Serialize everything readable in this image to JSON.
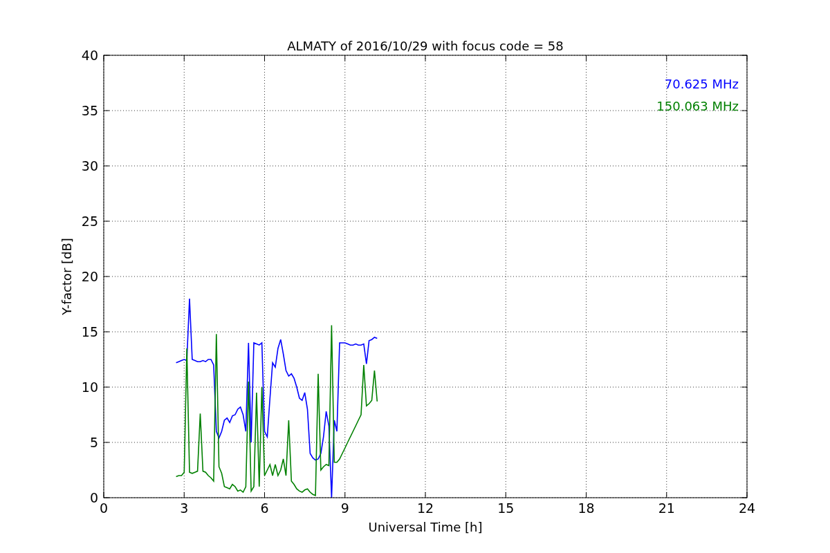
{
  "figure": {
    "chart_data": {
      "type": "line",
      "title": "ALMATY of 2016/10/29 with focus code = 58",
      "xlabel": "Universal Time [h]",
      "ylabel": "Y-factor [dB]",
      "x": [
        2.7,
        2.8,
        2.9,
        3.0,
        3.1,
        3.2,
        3.3,
        3.4,
        3.5,
        3.6,
        3.7,
        3.8,
        3.9,
        4.0,
        4.1,
        4.2,
        4.3,
        4.4,
        4.5,
        4.6,
        4.7,
        4.8,
        4.9,
        5.0,
        5.1,
        5.2,
        5.3,
        5.4,
        5.5,
        5.6,
        5.7,
        5.8,
        5.9,
        6.0,
        6.1,
        6.2,
        6.3,
        6.4,
        6.5,
        6.6,
        6.7,
        6.8,
        6.9,
        7.0,
        7.1,
        7.2,
        7.3,
        7.4,
        7.5,
        7.6,
        7.7,
        7.8,
        7.9,
        8.0,
        8.1,
        8.2,
        8.3,
        8.4,
        8.5,
        8.6,
        8.7,
        8.8,
        8.9,
        9.0,
        9.1,
        9.2,
        9.3,
        9.4,
        9.5,
        9.6,
        9.7,
        9.8,
        9.9,
        10.0,
        10.1,
        10.2
      ],
      "series": [
        {
          "name": "70.625 MHz",
          "color": "#0000ff",
          "values": [
            12.2,
            12.3,
            12.4,
            12.5,
            12.4,
            18.0,
            12.5,
            12.4,
            12.3,
            12.3,
            12.4,
            12.3,
            12.5,
            12.5,
            12.0,
            6.0,
            5.4,
            6.0,
            7.0,
            7.2,
            6.8,
            7.4,
            7.5,
            8.0,
            8.2,
            7.5,
            6.0,
            14.0,
            5.0,
            14.0,
            13.9,
            13.8,
            14.0,
            6.0,
            5.5,
            9.0,
            12.2,
            11.8,
            13.5,
            14.3,
            13.0,
            11.5,
            11.0,
            11.2,
            10.8,
            10.0,
            9.0,
            8.8,
            9.5,
            8.0,
            4.0,
            3.6,
            3.4,
            3.5,
            4.0,
            5.5,
            7.8,
            6.5,
            0,
            7.0,
            6.0,
            14.0,
            14.0,
            14.0,
            13.9,
            13.8,
            13.8,
            13.9,
            13.8,
            13.8,
            13.9,
            12.1,
            14.2,
            14.3,
            14.5,
            14.4
          ]
        },
        {
          "name": "150.063 MHz",
          "color": "#008000",
          "values": [
            1.9,
            2.0,
            2.0,
            2.3,
            13.5,
            2.3,
            2.2,
            2.3,
            2.4,
            7.6,
            2.4,
            2.3,
            2.0,
            1.8,
            1.5,
            14.8,
            2.8,
            2.2,
            1.0,
            0.9,
            0.8,
            1.2,
            1.0,
            0.6,
            0.7,
            0.5,
            1.0,
            10.5,
            0.6,
            1.0,
            9.5,
            1.0,
            10.0,
            2.0,
            2.5,
            3.0,
            2.0,
            3.0,
            2.0,
            2.5,
            3.5,
            2.0,
            7.0,
            1.5,
            1.2,
            0.8,
            0.6,
            0.5,
            0.7,
            0.8,
            0.5,
            0.3,
            0.2,
            11.2,
            2.5,
            2.8,
            3.0,
            2.9,
            15.6,
            3.2,
            3.2,
            3.5,
            4.0,
            4.5,
            5.0,
            5.5,
            6.0,
            6.5,
            7.0,
            7.5,
            12.0,
            8.3,
            8.5,
            8.8,
            11.5,
            8.7
          ]
        }
      ],
      "xlim": [
        0,
        24
      ],
      "ylim": [
        0,
        40
      ],
      "grid": true,
      "xticks": [
        0,
        3,
        6,
        9,
        12,
        15,
        18,
        21,
        24
      ],
      "yticks": [
        0,
        5,
        10,
        15,
        20,
        25,
        30,
        35,
        40
      ]
    }
  }
}
